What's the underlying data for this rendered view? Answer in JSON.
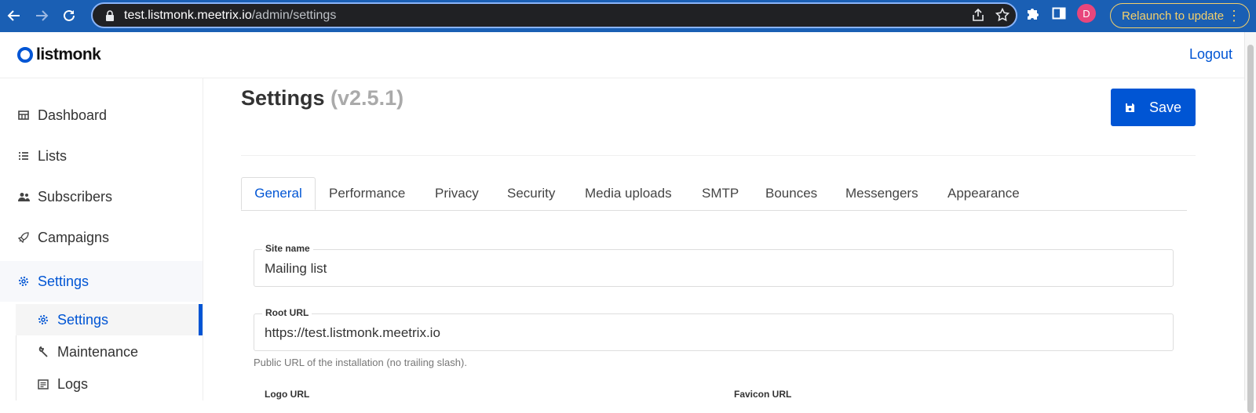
{
  "browser": {
    "url_host": "test.listmonk.meetrix.io",
    "url_path": "/admin/settings",
    "profile_initial": "D",
    "relaunch_label": "Relaunch to update",
    "menu_glyph": "⋮"
  },
  "header": {
    "logo_text": "listmonk",
    "logout_label": "Logout"
  },
  "sidebar": {
    "items": [
      {
        "label": "Dashboard",
        "icon": "dashboard-icon"
      },
      {
        "label": "Lists",
        "icon": "list-icon"
      },
      {
        "label": "Subscribers",
        "icon": "users-icon"
      },
      {
        "label": "Campaigns",
        "icon": "rocket-icon"
      },
      {
        "label": "Settings",
        "icon": "gear-icon"
      }
    ],
    "sub_items": [
      {
        "label": "Settings",
        "icon": "gear-icon"
      },
      {
        "label": "Maintenance",
        "icon": "wrench-icon"
      },
      {
        "label": "Logs",
        "icon": "log-icon"
      }
    ]
  },
  "main": {
    "title": "Settings",
    "version": "(v2.5.1)",
    "save_label": "Save",
    "tabs": [
      {
        "label": "General"
      },
      {
        "label": "Performance"
      },
      {
        "label": "Privacy"
      },
      {
        "label": "Security"
      },
      {
        "label": "Media uploads"
      },
      {
        "label": "SMTP"
      },
      {
        "label": "Bounces"
      },
      {
        "label": "Messengers"
      },
      {
        "label": "Appearance"
      }
    ],
    "fields": {
      "site_name": {
        "label": "Site name",
        "value": "Mailing list"
      },
      "root_url": {
        "label": "Root URL",
        "value": "https://test.listmonk.meetrix.io",
        "help": "Public URL of the installation (no trailing slash)."
      },
      "logo_url": {
        "label": "Logo URL"
      },
      "favicon_url": {
        "label": "Favicon URL"
      }
    }
  },
  "colors": {
    "accent": "#0055d4",
    "chrome_bar": "#1a5fb4",
    "relaunch": "#f4d06a"
  }
}
